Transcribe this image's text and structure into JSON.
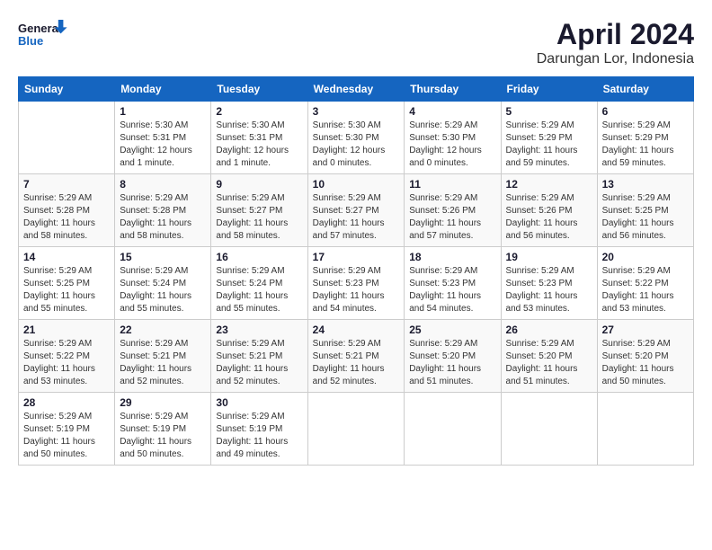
{
  "logo": {
    "line1": "General",
    "line2": "Blue"
  },
  "title": "April 2024",
  "subtitle": "Darungan Lor, Indonesia",
  "weekdays": [
    "Sunday",
    "Monday",
    "Tuesday",
    "Wednesday",
    "Thursday",
    "Friday",
    "Saturday"
  ],
  "weeks": [
    [
      {
        "day": "",
        "info": ""
      },
      {
        "day": "1",
        "info": "Sunrise: 5:30 AM\nSunset: 5:31 PM\nDaylight: 12 hours\nand 1 minute."
      },
      {
        "day": "2",
        "info": "Sunrise: 5:30 AM\nSunset: 5:31 PM\nDaylight: 12 hours\nand 1 minute."
      },
      {
        "day": "3",
        "info": "Sunrise: 5:30 AM\nSunset: 5:30 PM\nDaylight: 12 hours\nand 0 minutes."
      },
      {
        "day": "4",
        "info": "Sunrise: 5:29 AM\nSunset: 5:30 PM\nDaylight: 12 hours\nand 0 minutes."
      },
      {
        "day": "5",
        "info": "Sunrise: 5:29 AM\nSunset: 5:29 PM\nDaylight: 11 hours\nand 59 minutes."
      },
      {
        "day": "6",
        "info": "Sunrise: 5:29 AM\nSunset: 5:29 PM\nDaylight: 11 hours\nand 59 minutes."
      }
    ],
    [
      {
        "day": "7",
        "info": "Sunrise: 5:29 AM\nSunset: 5:28 PM\nDaylight: 11 hours\nand 58 minutes."
      },
      {
        "day": "8",
        "info": "Sunrise: 5:29 AM\nSunset: 5:28 PM\nDaylight: 11 hours\nand 58 minutes."
      },
      {
        "day": "9",
        "info": "Sunrise: 5:29 AM\nSunset: 5:27 PM\nDaylight: 11 hours\nand 58 minutes."
      },
      {
        "day": "10",
        "info": "Sunrise: 5:29 AM\nSunset: 5:27 PM\nDaylight: 11 hours\nand 57 minutes."
      },
      {
        "day": "11",
        "info": "Sunrise: 5:29 AM\nSunset: 5:26 PM\nDaylight: 11 hours\nand 57 minutes."
      },
      {
        "day": "12",
        "info": "Sunrise: 5:29 AM\nSunset: 5:26 PM\nDaylight: 11 hours\nand 56 minutes."
      },
      {
        "day": "13",
        "info": "Sunrise: 5:29 AM\nSunset: 5:25 PM\nDaylight: 11 hours\nand 56 minutes."
      }
    ],
    [
      {
        "day": "14",
        "info": "Sunrise: 5:29 AM\nSunset: 5:25 PM\nDaylight: 11 hours\nand 55 minutes."
      },
      {
        "day": "15",
        "info": "Sunrise: 5:29 AM\nSunset: 5:24 PM\nDaylight: 11 hours\nand 55 minutes."
      },
      {
        "day": "16",
        "info": "Sunrise: 5:29 AM\nSunset: 5:24 PM\nDaylight: 11 hours\nand 55 minutes."
      },
      {
        "day": "17",
        "info": "Sunrise: 5:29 AM\nSunset: 5:23 PM\nDaylight: 11 hours\nand 54 minutes."
      },
      {
        "day": "18",
        "info": "Sunrise: 5:29 AM\nSunset: 5:23 PM\nDaylight: 11 hours\nand 54 minutes."
      },
      {
        "day": "19",
        "info": "Sunrise: 5:29 AM\nSunset: 5:23 PM\nDaylight: 11 hours\nand 53 minutes."
      },
      {
        "day": "20",
        "info": "Sunrise: 5:29 AM\nSunset: 5:22 PM\nDaylight: 11 hours\nand 53 minutes."
      }
    ],
    [
      {
        "day": "21",
        "info": "Sunrise: 5:29 AM\nSunset: 5:22 PM\nDaylight: 11 hours\nand 53 minutes."
      },
      {
        "day": "22",
        "info": "Sunrise: 5:29 AM\nSunset: 5:21 PM\nDaylight: 11 hours\nand 52 minutes."
      },
      {
        "day": "23",
        "info": "Sunrise: 5:29 AM\nSunset: 5:21 PM\nDaylight: 11 hours\nand 52 minutes."
      },
      {
        "day": "24",
        "info": "Sunrise: 5:29 AM\nSunset: 5:21 PM\nDaylight: 11 hours\nand 52 minutes."
      },
      {
        "day": "25",
        "info": "Sunrise: 5:29 AM\nSunset: 5:20 PM\nDaylight: 11 hours\nand 51 minutes."
      },
      {
        "day": "26",
        "info": "Sunrise: 5:29 AM\nSunset: 5:20 PM\nDaylight: 11 hours\nand 51 minutes."
      },
      {
        "day": "27",
        "info": "Sunrise: 5:29 AM\nSunset: 5:20 PM\nDaylight: 11 hours\nand 50 minutes."
      }
    ],
    [
      {
        "day": "28",
        "info": "Sunrise: 5:29 AM\nSunset: 5:19 PM\nDaylight: 11 hours\nand 50 minutes."
      },
      {
        "day": "29",
        "info": "Sunrise: 5:29 AM\nSunset: 5:19 PM\nDaylight: 11 hours\nand 50 minutes."
      },
      {
        "day": "30",
        "info": "Sunrise: 5:29 AM\nSunset: 5:19 PM\nDaylight: 11 hours\nand 49 minutes."
      },
      {
        "day": "",
        "info": ""
      },
      {
        "day": "",
        "info": ""
      },
      {
        "day": "",
        "info": ""
      },
      {
        "day": "",
        "info": ""
      }
    ]
  ]
}
